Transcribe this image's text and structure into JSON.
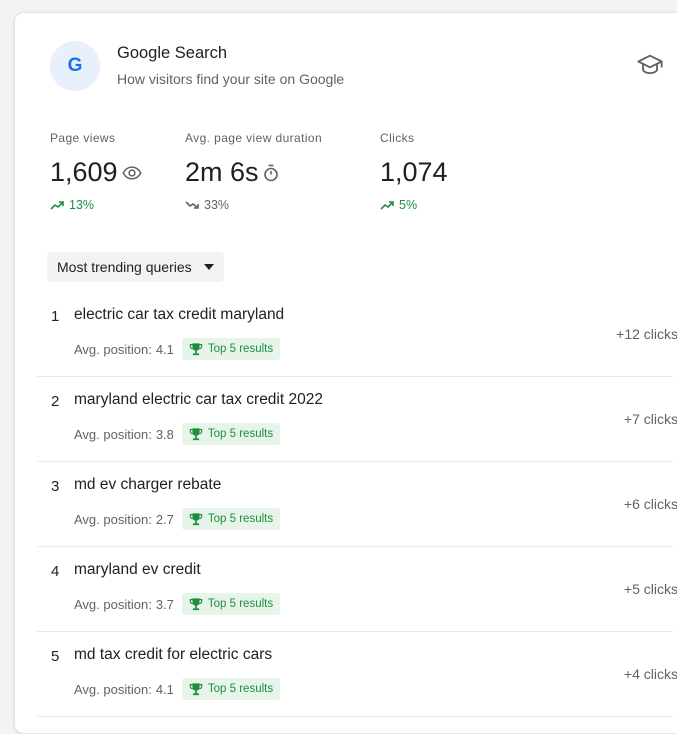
{
  "header": {
    "logo_letter": "G",
    "title": "Google Search",
    "subtitle": "How visitors find your site on Google",
    "learn_icon": "graduation-cap-icon"
  },
  "metrics": [
    {
      "label": "Page views",
      "value": "1,609",
      "icon": "eye-icon",
      "change": "13%",
      "trend": "up",
      "trend_color": "#1e8e3e"
    },
    {
      "label": "Avg. page view duration",
      "value": "2m 6s",
      "icon": "timer-icon",
      "change": "33%",
      "trend": "down",
      "trend_color": "#5f6368"
    },
    {
      "label": "Clicks",
      "value": "1,074",
      "icon": null,
      "change": "5%",
      "trend": "up",
      "trend_color": "#1e8e3e"
    }
  ],
  "queries_dropdown": {
    "label": "Most trending queries",
    "icon": "caret-down-icon"
  },
  "queries": [
    {
      "rank": "1",
      "query": "electric car tax credit maryland",
      "pos_label": "Avg. position:",
      "pos_value": "4.1",
      "badge": "Top 5 results",
      "clicks": "+12 clicks"
    },
    {
      "rank": "2",
      "query": "maryland electric car tax credit 2022",
      "pos_label": "Avg. position:",
      "pos_value": "3.8",
      "badge": "Top 5 results",
      "clicks": "+7 clicks"
    },
    {
      "rank": "3",
      "query": "md ev charger rebate",
      "pos_label": "Avg. position:",
      "pos_value": "2.7",
      "badge": "Top 5 results",
      "clicks": "+6 clicks"
    },
    {
      "rank": "4",
      "query": "maryland ev credit",
      "pos_label": "Avg. position:",
      "pos_value": "3.7",
      "badge": "Top 5 results",
      "clicks": "+5 clicks"
    },
    {
      "rank": "5",
      "query": "md tax credit for electric cars",
      "pos_label": "Avg. position:",
      "pos_value": "4.1",
      "badge": "Top 5 results",
      "clicks": "+4 clicks"
    }
  ],
  "colors": {
    "accent": "#1a73e8",
    "positive": "#1e8e3e",
    "badge_bg": "#e6f4ea"
  }
}
